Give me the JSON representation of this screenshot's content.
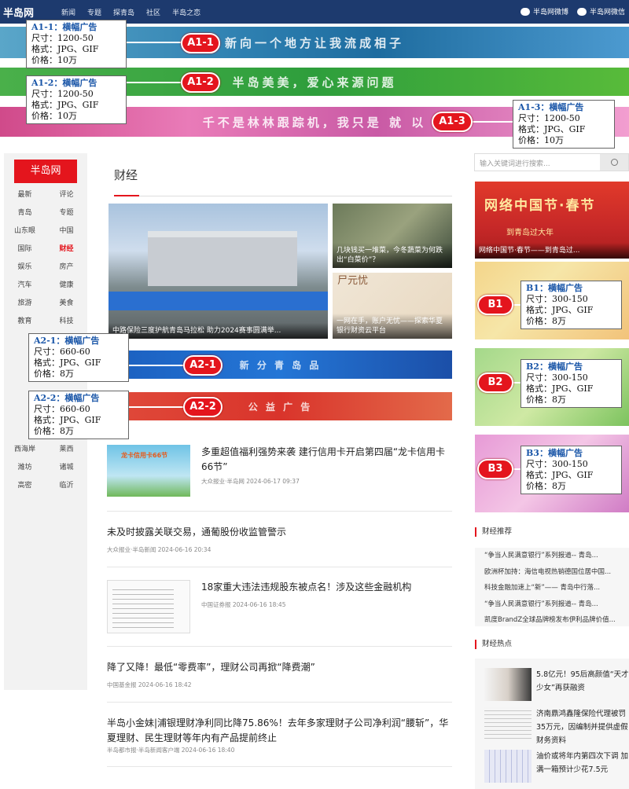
{
  "header": {
    "logo": "半岛网",
    "nav": [
      "新闻",
      "专题",
      "探青岛",
      "社区",
      "半岛之恋"
    ],
    "weibo": "半岛网微博",
    "weixin": "半岛网微信"
  },
  "banners": {
    "a1_1": {
      "text": "新向一个地方让我流成相子",
      "tag": "A1-1",
      "title": "A1-1：横幅广告",
      "size": "尺寸：1200-50",
      "format": "格式：JPG、GIF",
      "price": "价格：10万"
    },
    "a1_2": {
      "text": "半岛美美，爱心来源问题",
      "tag": "A1-2",
      "title": "A1-2：横幅广告",
      "size": "尺寸：1200-50",
      "format": "格式：JPG、GIF",
      "price": "价格：10万"
    },
    "a1_3": {
      "text": "千不是林林跟踪机，我只是 就 以",
      "tag": "A1-3",
      "title": "A1-3：横幅广告",
      "size": "尺寸：1200-50",
      "format": "格式：JPG、GIF",
      "price": "价格：10万"
    }
  },
  "sidebar": {
    "brand": "半岛网",
    "items": [
      "最新",
      "评论",
      "青岛",
      "专题",
      "山东眼",
      "中国",
      "国际",
      "财经",
      "娱乐",
      "房产",
      "汽车",
      "健康",
      "旅游",
      "美食",
      "教育",
      "科技"
    ],
    "items2": [
      "西海岸",
      "莱西",
      "潍坊",
      "诸城",
      "高密",
      "临沂"
    ],
    "active": "财经"
  },
  "section": {
    "title": "财经"
  },
  "hero": {
    "caption": "中路保险三度护航青岛马拉松 助力2024赛事圆满举..."
  },
  "thumb1": {
    "caption": "几块钱买一堆菜，今冬蔬菜为何跌出“白菜价”？"
  },
  "thumb2": {
    "art": "尸元忧",
    "caption": "一网在手，账户无忧——探索华夏银行财资云平台"
  },
  "ads2": {
    "a2_1": {
      "text": "新 分 青 岛 品",
      "tag": "A2-1",
      "title": "A2-1：横幅广告",
      "size": "尺寸：660-60",
      "format": "格式：JPG、GIF",
      "price": "价格：8万"
    },
    "a2_2": {
      "text": "公 益 广 告",
      "tag": "A2-2",
      "title": "A2-2：横幅广告",
      "size": "尺寸：660-60",
      "format": "格式：JPG、GIF",
      "price": "价格：8万"
    }
  },
  "articles": [
    {
      "title": "多重超值福利强势来袭 建行信用卡开启第四届“龙卡信用卡66节”",
      "meta": "大众报业·半岛网 2024-06-17 09:37",
      "thumb_text": "龙卡信用卡66节"
    },
    {
      "title": "未及时披露关联交易，通葡股份收监管警示",
      "meta": "大众报业·半岛新闻 2024-06-16 20:34"
    },
    {
      "title": "18家重大违法违规股东被点名！涉及这些金融机构",
      "meta": "中国证券报 2024-06-16 18:45"
    },
    {
      "title": "降了又降！最低“零费率”，理财公司再掀“降费潮”",
      "meta": "中国基金报 2024-06-16 18:42"
    },
    {
      "title": "半岛小金妹|浦银理财净利同比降75.86%！去年多家理财子公司净利润“腰斩”，华夏理财、民生理财等年内有产品提前终止",
      "meta": "半岛都市报·半岛新闻客户端 2024-06-16 18:40"
    }
  ],
  "right": {
    "search_placeholder": "输入关键词进行搜索...",
    "top_big": "网络中国节·春节",
    "top_small": "到青岛过大年",
    "top_caption": "网络中国节·春节——到青岛过...",
    "b1": {
      "tag": "B1",
      "title": "B1：横幅广告",
      "size": "尺寸：300-150",
      "format": "格式：JPG、GIF",
      "price": "价格：8万"
    },
    "b2": {
      "tag": "B2",
      "title": "B2：横幅广告",
      "size": "尺寸：300-150",
      "format": "格式：JPG、GIF",
      "price": "价格：8万"
    },
    "b3": {
      "tag": "B3",
      "title": "B3：横幅广告",
      "size": "尺寸：300-150",
      "format": "格式：JPG、GIF",
      "price": "价格：8万"
    },
    "rec_head": "财经推荐",
    "rec": [
      "“争当人民满意银行”系列报道-- 青岛...",
      "欧洲杯加持：海信电视热销德国位居中国...",
      "科技金融加速上“新”—— 青岛中行落...",
      "“争当人民满意银行”系列报道-- 青岛...",
      "凯度BrandZ全球品牌榜发布伊利品牌价值..."
    ],
    "hot_head": "财经热点",
    "hot": [
      {
        "title": "5.8亿元！95后高颜值“天才少女”再获融资"
      },
      {
        "title": "济南鼎鸿鑫隆保险代理被罚35万元，因编制并提供虚假财务资料"
      },
      {
        "title": "油价或将年内第四次下调 加满一箱预计少花7.5元"
      }
    ]
  }
}
